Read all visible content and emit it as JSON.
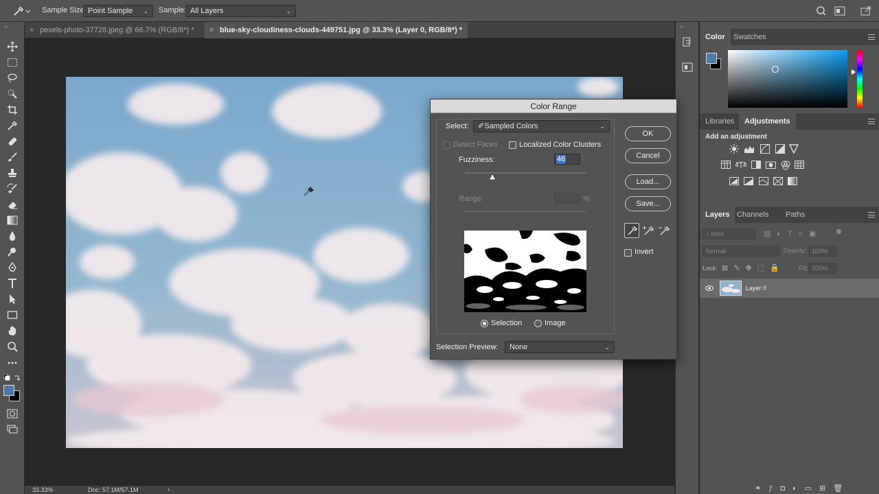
{
  "options_bar": {
    "sample_size_label": "Sample Size:",
    "sample_size_value": "Point Sample",
    "sample_label": "Sample:",
    "sample_value": "All Layers"
  },
  "tabs": [
    {
      "label": "pexels-photo-37728.jpeg @ 66.7% (RGB/8*) *",
      "close": "×"
    },
    {
      "label": "blue-sky-cloudiness-clouds-449751.jpg @ 33.3% (Layer 0, RGB/8*) *",
      "close": "×"
    }
  ],
  "status": {
    "zoom": "33.33%",
    "doc": "Doc: 57.1M/57.1M",
    "arrow": "›"
  },
  "color_panel": {
    "tabs": [
      "Color",
      "Swatches"
    ],
    "foreground": "#4d7aa2",
    "background": "#000000"
  },
  "adjustments_panel": {
    "tabs": [
      "Libraries",
      "Adjustments"
    ],
    "add_label": "Add an adjustment"
  },
  "layers_panel": {
    "tabs": [
      "Layers",
      "Channels",
      "Paths"
    ],
    "kind_placeholder": "Kind",
    "blend_mode": "Normal",
    "opacity_label": "Opacity:",
    "opacity_value": "100%",
    "lock_label": "Lock:",
    "fill_label": "Fill:",
    "fill_value": "100%",
    "layer_name": "Layer 0"
  },
  "dialog": {
    "title": "Color Range",
    "select_label": "Select:",
    "select_value": "Sampled Colors",
    "detect_faces": "Detect Faces",
    "localized_clusters": "Localized Color Clusters",
    "fuzziness_label": "Fuzziness:",
    "fuzziness_value": "46",
    "range_label": "Range:",
    "range_unit": "%",
    "radio_selection": "Selection",
    "radio_image": "Image",
    "preview_label": "Selection Preview:",
    "preview_value": "None",
    "buttons": {
      "ok": "OK",
      "cancel": "Cancel",
      "load": "Load...",
      "save": "Save..."
    },
    "invert_label": "Invert"
  }
}
